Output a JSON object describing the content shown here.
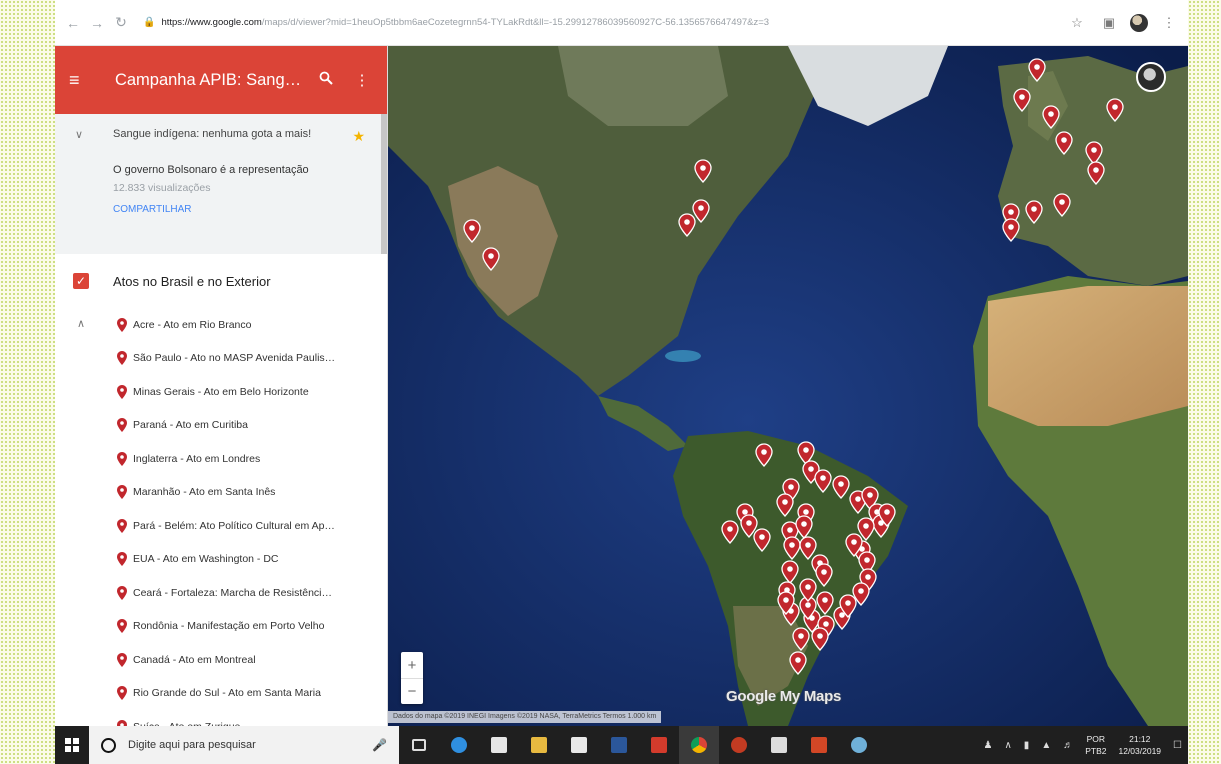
{
  "browser": {
    "url_host": "https://www.google.com",
    "url_path": "/maps/d/viewer?mid=1heuOp5tbbm6aeCozetegrnn54-TYLakRdt&ll=-15.29912786039560927C-56.1356576647497&z=3"
  },
  "panel": {
    "title": "Campanha APIB: Sang…",
    "description_title": "Sangue indígena: nenhuma gota a mais!",
    "description_text": "O governo Bolsonaro é a representação",
    "views": "12.833 visualizações",
    "share_label": "COMPARTILHAR",
    "layer_title": "Atos no Brasil e no Exterior",
    "items": [
      {
        "label": "Acre - Ato em Rio Branco"
      },
      {
        "label": "São Paulo - Ato no MASP Avenida Paulis…"
      },
      {
        "label": "Minas Gerais - Ato em Belo Horizonte"
      },
      {
        "label": "Paraná - Ato em Curitiba"
      },
      {
        "label": "Inglaterra - Ato em Londres"
      },
      {
        "label": "Maranhão - Ato em Santa Inês"
      },
      {
        "label": "Pará - Belém: Ato Político Cultural em Ap…"
      },
      {
        "label": "EUA - Ato em Washington - DC"
      },
      {
        "label": "Ceará - Fortaleza: Marcha de Resistênci…"
      },
      {
        "label": "Rondônia - Manifestação em Porto Velho"
      },
      {
        "label": "Canadá - Ato em Montreal"
      },
      {
        "label": "Rio Grande do Sul - Ato em Santa Maria"
      },
      {
        "label": "Suíça - Ato em Zurique"
      }
    ]
  },
  "map": {
    "zoom_in": "+",
    "zoom_out": "−",
    "logo": "Google My Maps",
    "attribution": "Dados do mapa ©2019 INEGI Imagens ©2019 NASA, TerraMetrics   Termos   1.000 km",
    "marker_color": "#c1272d"
  },
  "taskbar": {
    "search_placeholder": "Digite aqui para pesquisar",
    "language": "POR",
    "keyboard": "PTB2",
    "time": "21:12",
    "date": "12/03/2019"
  }
}
